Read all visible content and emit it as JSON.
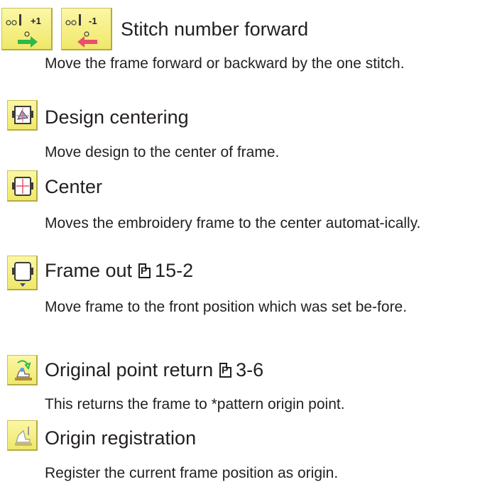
{
  "entries": [
    {
      "title": "Stitch number forward",
      "description": "Move the frame forward or backward by the one stitch.",
      "icons": [
        "stitch-forward-plus-one-icon",
        "stitch-backward-minus-one-icon"
      ],
      "icon_labels": [
        "+1",
        "-1"
      ]
    },
    {
      "title": "Design centering",
      "description": "Move design to the center of frame.",
      "icons": [
        "design-centering-icon"
      ]
    },
    {
      "title": "Center",
      "description": "Moves the embroidery frame to the center automat-ically.",
      "icons": [
        "frame-center-icon"
      ]
    },
    {
      "title": "Frame out",
      "reference": "15-2",
      "reference_icon_letter": "P",
      "description": "Move frame to the front position which was set be-fore.",
      "icons": [
        "frame-out-icon"
      ]
    },
    {
      "title": "Original point return",
      "reference": "3-6",
      "reference_icon_letter": "P",
      "description": "This returns the frame to *pattern origin point.",
      "icons": [
        "original-point-return-icon"
      ]
    },
    {
      "title": "Origin registration",
      "description": "Register the current frame position as origin.",
      "icons": [
        "origin-registration-icon"
      ]
    }
  ],
  "colors": {
    "icon_background": "#f4ee7c",
    "text": "#231f20",
    "arrow_green": "#2eb84a",
    "arrow_pink": "#e8506e"
  }
}
